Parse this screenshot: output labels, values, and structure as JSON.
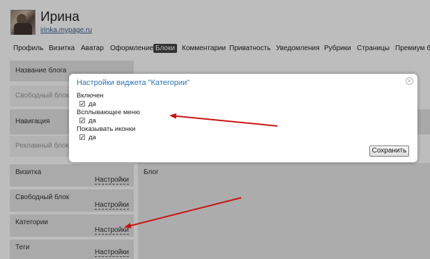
{
  "header": {
    "user_name": "Ирина",
    "user_link": "irinka.mypage.ru"
  },
  "nav": {
    "items": [
      {
        "label": "Профиль"
      },
      {
        "label": "Визитка"
      },
      {
        "label": "Аватар"
      },
      {
        "label": "Оформление"
      },
      {
        "label": "Блоки"
      },
      {
        "label": "Комментарии"
      },
      {
        "label": "Приватность"
      },
      {
        "label": "Уведомления"
      },
      {
        "label": "Рубрики"
      },
      {
        "label": "Страницы"
      },
      {
        "label": "Премиум бл"
      }
    ],
    "active": "Блоки"
  },
  "blocks": {
    "rows": [
      {
        "label": "Название блога"
      },
      {
        "label": "Свободный блок"
      },
      {
        "label": "Навигация"
      },
      {
        "label": "Рекламный блок"
      }
    ]
  },
  "widgets": [
    {
      "title": "Визитка",
      "settings_label": "Настройки"
    },
    {
      "title": "Свободный блок",
      "settings_label": "Настройки"
    },
    {
      "title": "Категории",
      "settings_label": "Настройки"
    },
    {
      "title": "Теги",
      "settings_label": "Настройки"
    }
  ],
  "main": {
    "label": "Блог"
  },
  "dialog": {
    "title": "Настройки виджета \"Категории\"",
    "fields": [
      {
        "label": "Включен",
        "checkbox_label": "да",
        "checked": true
      },
      {
        "label": "Всплывающее меню",
        "checkbox_label": "да",
        "checked": true
      },
      {
        "label": "Показывать иконки",
        "checkbox_label": "да",
        "checked": true
      }
    ],
    "save_label": "Сохранить",
    "close_symbol": "×"
  },
  "colors": {
    "arrow": "#cc1111",
    "dialog_title": "#2d73b8",
    "active_tab": "#444444"
  }
}
